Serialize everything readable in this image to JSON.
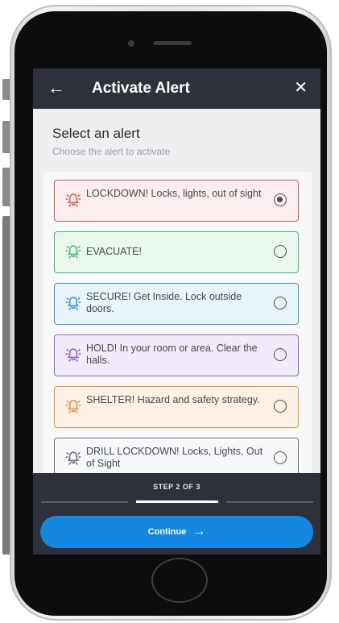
{
  "header": {
    "title": "Activate Alert",
    "back_icon": "←",
    "close_icon": "✕"
  },
  "main": {
    "heading": "Select an alert",
    "subheading": "Choose the alert to activate",
    "alerts": [
      {
        "label": "LOCKDOWN! Locks, lights, out of sight",
        "selected": true,
        "color": "#e05a5a",
        "bg": "#fbeeee"
      },
      {
        "label": "EVACUATE!",
        "selected": false,
        "color": "#4db870",
        "bg": "#e9f7ed"
      },
      {
        "label": "SECURE! Get Inside. Lock outside doors.",
        "selected": false,
        "color": "#3a96c9",
        "bg": "#e8f3fa"
      },
      {
        "label": "HOLD! In your room or area. Clear the halls.",
        "selected": false,
        "color": "#8f63c9",
        "bg": "#f1ebf9"
      },
      {
        "label": "SHELTER! Hazard and safety strategy.",
        "selected": false,
        "color": "#e8923d",
        "bg": "#fdf1e5"
      },
      {
        "label": "DRILL LOCKDOWN! Locks, Lights, Out of Sight",
        "selected": false,
        "color": "#6b6e73",
        "bg": "#f7f8f9"
      }
    ]
  },
  "footer": {
    "step_text": "STEP 2 OF 3",
    "step_current": 2,
    "step_total": 3,
    "continue_label": "Continue",
    "continue_icon": "→"
  },
  "colors": {
    "appbar": "#2e3139",
    "accent": "#1687e0"
  }
}
